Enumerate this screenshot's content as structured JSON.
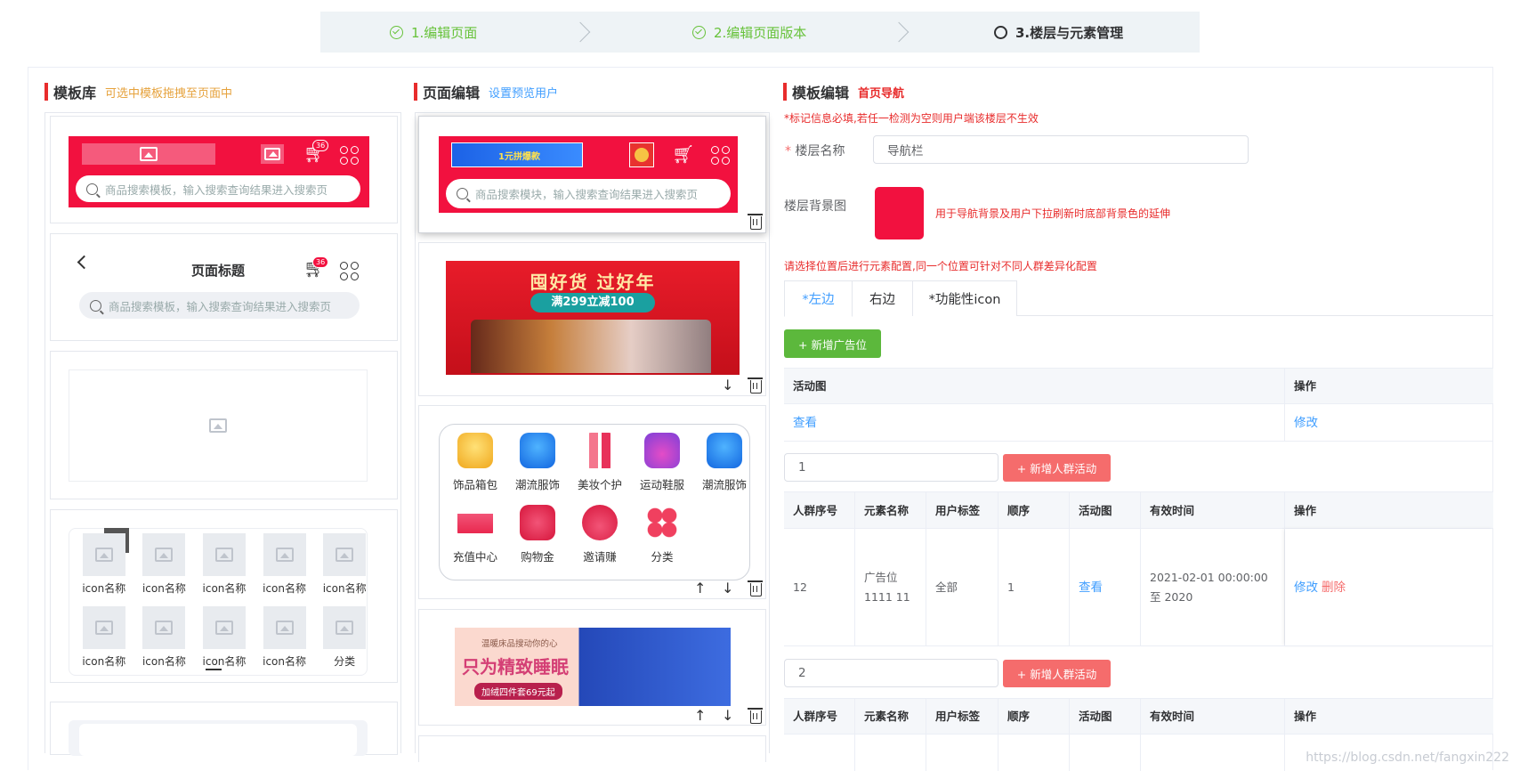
{
  "steps": [
    {
      "label": "1.编辑页面",
      "state": "done"
    },
    {
      "label": "2.编辑页面版本",
      "state": "done"
    },
    {
      "label": "3.楼层与元素管理",
      "state": "current"
    }
  ],
  "library": {
    "title": "模板库",
    "hint": "可选中模板拖拽至页面中",
    "search_placeholder": "商品搜索模板，输入搜索查询结果进入搜索页",
    "cart_badge": "36",
    "page_title": "页面标题",
    "icon_labels": [
      "icon名称",
      "icon名称",
      "icon名称",
      "icon名称",
      "icon名称",
      "icon名称",
      "icon名称",
      "icon名称",
      "icon名称",
      "分类"
    ]
  },
  "editor": {
    "title": "页面编辑",
    "link": "设置预览用户",
    "search_placeholder": "商品搜索模块，输入搜索查询结果进入搜索页",
    "nav_ad_text": "1元拼爆款",
    "banner": {
      "title": "囤好货 过好年",
      "sub": "满299立减100"
    },
    "categories": [
      "饰品箱包",
      "潮流服饰",
      "美妆个护",
      "运动鞋服",
      "潮流服饰",
      "充值中心",
      "购物金",
      "邀请赚",
      "分类"
    ],
    "bed_banner": {
      "line1": "温暖床品搜动你的心",
      "line2": "只为精致睡眠",
      "line3": "加绒四件套69元起"
    }
  },
  "template": {
    "title": "模板编辑",
    "subtitle": "首页导航",
    "notice": "*标记信息必填,若任一检测为空则用户端该楼层不生效",
    "floor_name_label": "楼层名称",
    "floor_name_value": "导航栏",
    "bg_label": "楼层背景图",
    "bg_color": "#f2113f",
    "bg_hint": "用于导航背景及用户下拉刷新时底部背景色的延伸",
    "position_hint": "请选择位置后进行元素配置,同一个位置可针对不同人群差异化配置",
    "tabs": [
      "*左边",
      "右边",
      "*功能性icon"
    ],
    "add_ad_btn": "+ 新增广告位",
    "ad_table": {
      "headers": [
        "活动图",
        "操作"
      ],
      "row": [
        "查看",
        "修改"
      ]
    },
    "group1": {
      "value": "1",
      "btn": "+ 新增人群活动"
    },
    "group2": {
      "value": "2",
      "btn": "+ 新增人群活动"
    },
    "crowd_headers": [
      "人群序号",
      "元素名称",
      "用户标签",
      "顺序",
      "活动图",
      "有效时间",
      "操作"
    ],
    "crowd_row": {
      "seq": "12",
      "name": "广告位1111 11",
      "tag": "全部",
      "order": "1",
      "img": "查看",
      "time": "2021-02-01 00:00:00 至 2020",
      "edit": "修改",
      "delete": "删除"
    }
  },
  "watermark": "https://blog.csdn.net/fangxin222"
}
